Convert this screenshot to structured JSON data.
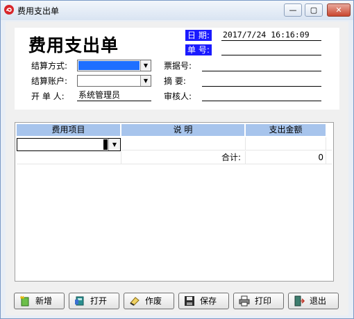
{
  "window": {
    "title": "费用支出单",
    "min": "—",
    "max": "▢",
    "close": "✕"
  },
  "form": {
    "title": "费用支出单",
    "date_label": "日 期:",
    "date_value": "2017/7/24 16:16:09",
    "number_label": "单 号:",
    "number_value": "",
    "settle_method_label": "结算方式:",
    "settle_account_label": "结算账户:",
    "opener_label": "开 单 人:",
    "opener_value": "系统管理员",
    "invoice_label": "票据号:",
    "summary_label": "摘   要:",
    "reviewer_label": "审核人:"
  },
  "grid": {
    "columns": [
      "费用项目",
      "说     明",
      "支出金额"
    ],
    "total_label": "合计:",
    "total_value": "0"
  },
  "buttons": {
    "new": "新增",
    "open": "打开",
    "void": "作废",
    "save": "保存",
    "print": "打印",
    "exit": "退出"
  },
  "colors": {
    "highlight_label": "#1a1aff",
    "selection": "#1f6fff",
    "grid_header": "#a7c4ec"
  }
}
